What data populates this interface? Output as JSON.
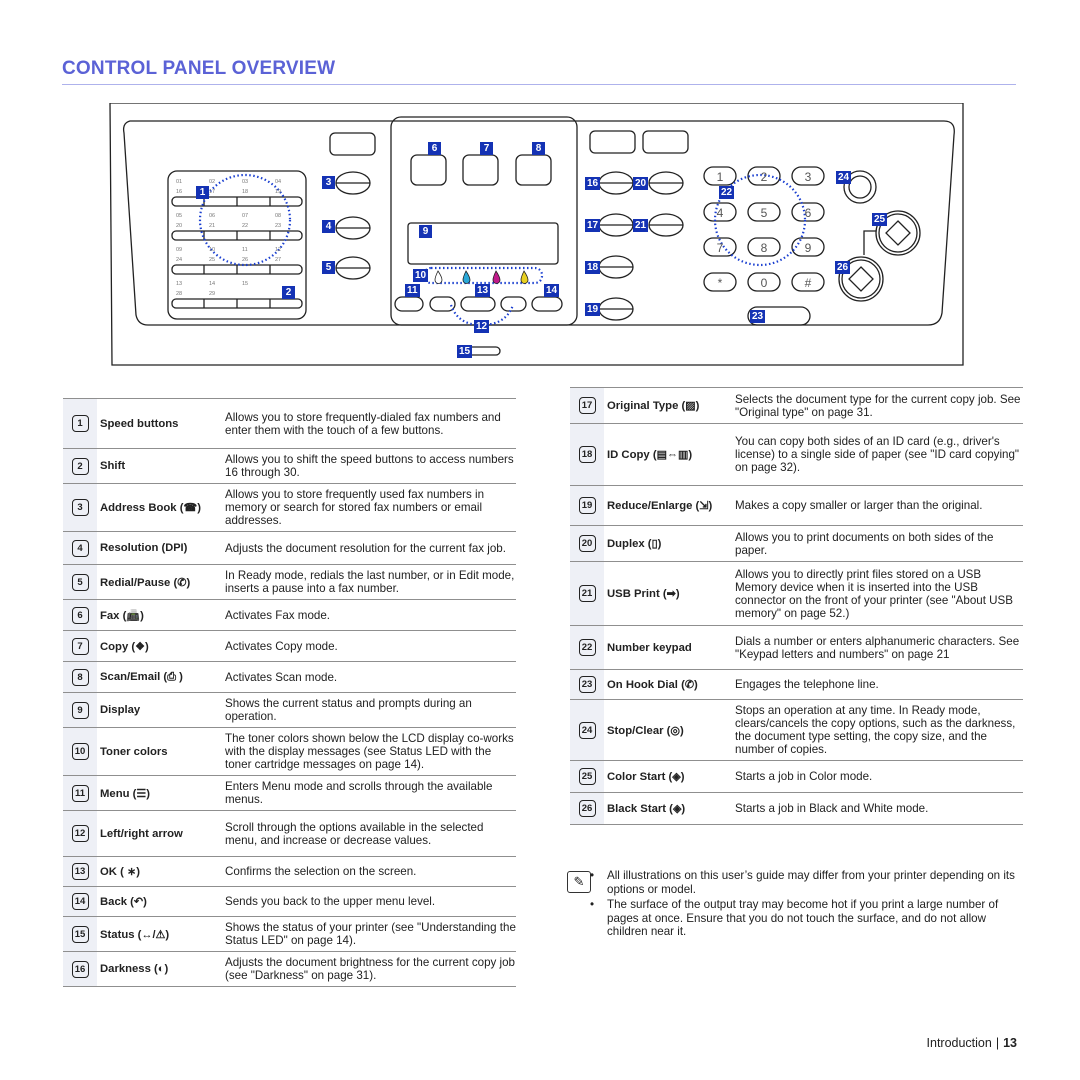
{
  "page": {
    "title": "CONTROL PANEL OVERVIEW",
    "footer_section": "Introduction",
    "footer_separator": "|",
    "footer_page": "13",
    "accent_color": "#5b62d6",
    "callout_color": "#1432b4"
  },
  "panel": {
    "speed_labels_top": [
      "01",
      "02",
      "03",
      "04",
      "05",
      "06",
      "07",
      "08",
      "09",
      "10",
      "11",
      "12",
      "13",
      "14",
      "15"
    ],
    "speed_labels_bottom": [
      "16",
      "17",
      "18",
      "19",
      "20",
      "21",
      "22",
      "23",
      "24",
      "25",
      "26",
      "27",
      "28",
      "29"
    ],
    "keypad": [
      "1",
      "2",
      "3",
      "4",
      "5",
      "6",
      "7",
      "8",
      "9",
      "*",
      "0",
      "#"
    ],
    "callouts": [
      "1",
      "2",
      "3",
      "4",
      "5",
      "6",
      "7",
      "8",
      "9",
      "10",
      "11",
      "12",
      "13",
      "14",
      "15",
      "16",
      "17",
      "18",
      "19",
      "20",
      "21",
      "22",
      "23",
      "24",
      "25",
      "26"
    ],
    "toner_colors": [
      "#ffffff",
      "#2aa8d8",
      "#c01a8a",
      "#e8d020"
    ]
  },
  "left_table": [
    {
      "num": "1",
      "name": "Speed buttons",
      "icon": "",
      "desc": "Allows you to store frequently-dialed fax numbers and enter them with the touch of a few buttons."
    },
    {
      "num": "2",
      "name": "Shift",
      "icon": "",
      "desc": "Allows you to shift the speed buttons to access numbers 16 through 30."
    },
    {
      "num": "3",
      "name": "Address Book (",
      "icon": "☎",
      "close": ")",
      "desc": "Allows you to store frequently used fax numbers in memory or search for stored fax numbers or email addresses."
    },
    {
      "num": "4",
      "name": "Resolution (",
      "icon": "DPI",
      "close": ")",
      "desc": "Adjusts the document resolution for the current fax job."
    },
    {
      "num": "5",
      "name": "Redial/Pause (",
      "icon": "✆",
      "close": ")",
      "desc": "In Ready mode, redials the last number, or in Edit mode, inserts a pause into a fax number."
    },
    {
      "num": "6",
      "name": "Fax (",
      "icon": "📠",
      "close": ")",
      "desc": "Activates Fax mode."
    },
    {
      "num": "7",
      "name": "Copy (",
      "icon": "❖",
      "close": ")",
      "desc": "Activates Copy mode."
    },
    {
      "num": "8",
      "name": "Scan/Email (",
      "icon": "⎙",
      "close": " )",
      "desc": "Activates Scan mode."
    },
    {
      "num": "9",
      "name": "Display",
      "icon": "",
      "desc": "Shows the current status and prompts during an operation."
    },
    {
      "num": "10",
      "name": "Toner colors",
      "icon": "",
      "desc": "The toner colors shown below the LCD display co-works with the display messages (see Status LED with the toner cartridge messages on page 14)."
    },
    {
      "num": "11",
      "name": "Menu (",
      "icon": "☰",
      "close": ")",
      "desc": "Enters Menu mode and scrolls through the available menus."
    },
    {
      "num": "12",
      "name": "Left/right arrow",
      "icon": "",
      "desc": "Scroll through the options available in the selected menu, and increase or decrease values."
    },
    {
      "num": "13",
      "name": "OK ( ",
      "icon": "∗",
      "close": ")",
      "desc": "Confirms the selection on the screen."
    },
    {
      "num": "14",
      "name": "Back (",
      "icon": "↶",
      "close": ")",
      "desc": "Sends you back to the upper menu level."
    },
    {
      "num": "15",
      "name": "Status (",
      "icon": "↔/⚠",
      "close": ")",
      "desc": "Shows the status of your printer (see \"Understanding the Status LED\" on page 14)."
    },
    {
      "num": "16",
      "name": "Darkness (",
      "icon": "◐",
      "close": ")",
      "desc": "Adjusts the document brightness for the current copy job (see \"Darkness\" on page 31)."
    }
  ],
  "right_table": [
    {
      "num": "17",
      "name": "Original Type (",
      "icon": "▨",
      "close": ")",
      "desc": "Selects the document type for the current copy job. See \"Original type\" on page 31."
    },
    {
      "num": "18",
      "name": "ID Copy (",
      "icon": "▤⇔▥",
      "close": ")",
      "desc": "You can copy both sides of an ID card (e.g., driver's license) to a single side of paper (see \"ID card copying\" on page 32)."
    },
    {
      "num": "19",
      "name": "Reduce/Enlarge (",
      "icon": "⇲",
      "close": ")",
      "desc": "Makes a copy smaller or larger than the original."
    },
    {
      "num": "20",
      "name": "Duplex (",
      "icon": "▯",
      "close": ")",
      "desc": "Allows you to print documents on both sides of the paper."
    },
    {
      "num": "21",
      "name": "USB Print (",
      "icon": "➡",
      "close": ")",
      "desc": "Allows you to directly print files stored on a USB Memory device when it is inserted into the USB connector on the front of your printer (see \"About USB memory\" on page 52.)"
    },
    {
      "num": "22",
      "name": "Number keypad",
      "icon": "",
      "desc": "Dials a number or enters alphanumeric characters. See \"Keypad letters and numbers\" on page 21"
    },
    {
      "num": "23",
      "name": "On Hook Dial (",
      "icon": "✆",
      "close": ")",
      "desc": "Engages the telephone line."
    },
    {
      "num": "24",
      "name": "Stop/Clear (",
      "icon": "◎",
      "close": ")",
      "desc": "Stops an operation at any time. In Ready mode, clears/cancels the copy options, such as the darkness, the document type setting, the copy size, and the number of copies."
    },
    {
      "num": "25",
      "name": "Color Start (",
      "icon": "◈",
      "close": ")",
      "desc": "Starts a job in Color mode."
    },
    {
      "num": "26",
      "name": "Black Start (",
      "icon": "◈",
      "close": ")",
      "desc": "Starts a job in Black and White mode."
    }
  ],
  "note": {
    "icon": "✎",
    "items": [
      "All illustrations on this user’s guide may differ from your printer depending on its options or model.",
      "The surface of the output tray may become hot if you print a large number of pages at once. Ensure that you do not touch the surface, and do not allow children near it."
    ]
  }
}
